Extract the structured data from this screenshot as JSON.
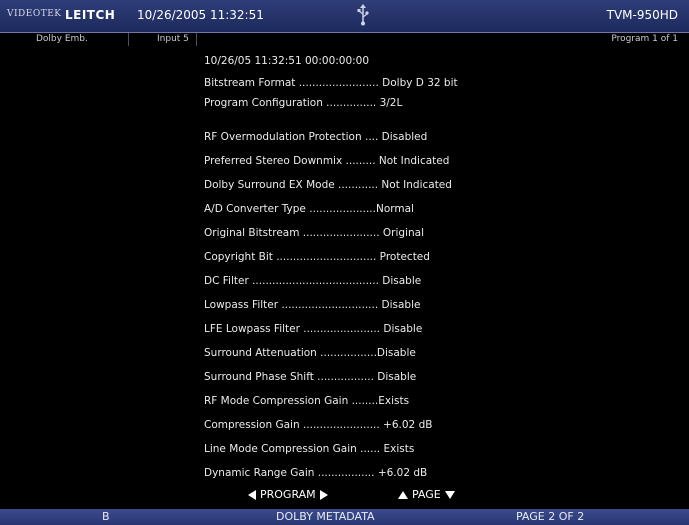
{
  "header": {
    "brand_small": "VIDEOTEK",
    "brand_main": "LEITCH",
    "datetime": "10/26/2005 11:32:51",
    "usb_icon": "usb-icon",
    "model": "TVM-950HD"
  },
  "infobar": {
    "mode": "Dolby Emb.",
    "input": "Input 5",
    "program": "Program 1 of 1"
  },
  "metadata": {
    "timestamp_line": "10/26/05     11:32:51     00:00:00:00",
    "rows": [
      "Bitstream Format ........................ Dolby D 32 bit",
      "Program Configuration ............... 3/2L",
      "RF Overmodulation Protection .... Disabled",
      "Preferred Stereo Downmix ......... Not Indicated",
      "Dolby Surround EX Mode ............ Not Indicated",
      "A/D Converter Type ....................Normal",
      "Original Bitstream ....................... Original",
      "Copyright Bit .............................. Protected",
      "DC Filter ...................................... Disable",
      "Lowpass Filter ............................. Disable",
      "LFE Lowpass Filter ....................... Disable",
      "Surround Attenuation .................Disable",
      "Surround Phase Shift ................. Disable",
      "RF Mode Compression Gain ........Exists",
      "Compression Gain ....................... +6.02 dB",
      "Line Mode Compression Gain ...... Exists",
      "Dynamic Range Gain ................. +6.02 dB"
    ]
  },
  "nav": {
    "program_label": "PROGRAM",
    "page_label": "PAGE"
  },
  "footer": {
    "left": "B",
    "title": "DOLBY METADATA",
    "page": "PAGE 2 OF 2"
  }
}
